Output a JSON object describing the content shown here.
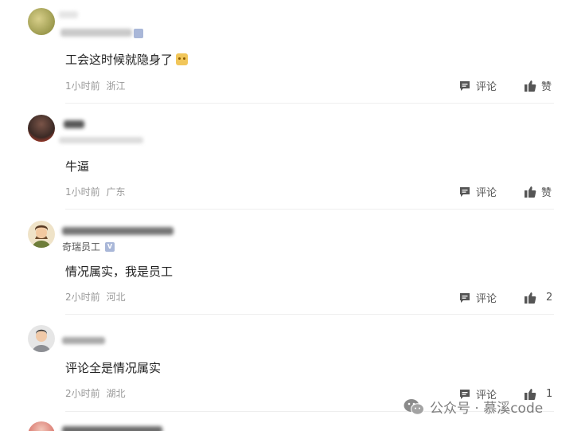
{
  "comments": [
    {
      "badge": "",
      "content": "工会这时候就隐身了",
      "has_emoji": true,
      "time": "1小时前",
      "location": "浙江",
      "comment_label": "评论",
      "like_label": "赞"
    },
    {
      "badge": "",
      "content": "牛逼",
      "has_emoji": false,
      "time": "1小时前",
      "location": "广东",
      "comment_label": "评论",
      "like_label": "赞"
    },
    {
      "badge": "奇瑞员工",
      "content": "情况属实，我是员工",
      "has_emoji": false,
      "time": "2小时前",
      "location": "河北",
      "comment_label": "评论",
      "like_label": "2"
    },
    {
      "badge": "",
      "content": "评论全是情况属实",
      "has_emoji": false,
      "time": "2小时前",
      "location": "湖北",
      "comment_label": "评论",
      "like_label": "1"
    }
  ],
  "watermark": {
    "text": "公众号 · 慕溪code"
  },
  "icons": {
    "comment": "comment-bubble-icon",
    "like": "thumbs-up-icon",
    "wechat": "wechat-logo-icon"
  },
  "colors": {
    "icon": "#555555",
    "meta": "#999999",
    "divider": "#eeeeee"
  }
}
